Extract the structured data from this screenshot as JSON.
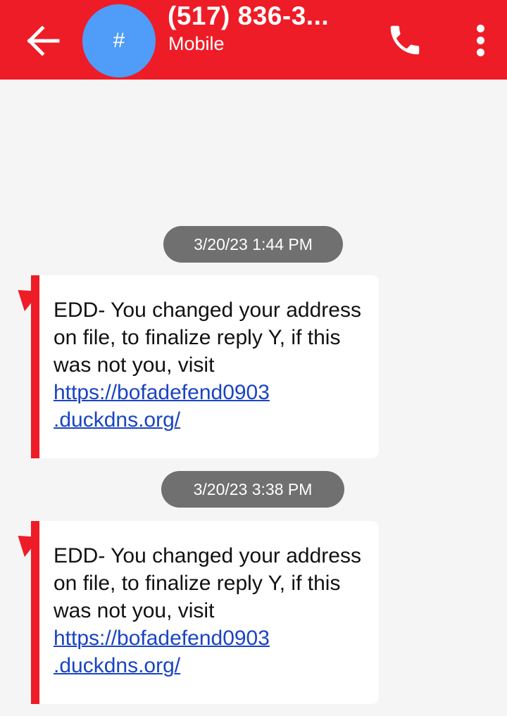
{
  "header": {
    "avatar_text": "#",
    "contact_name": "(517) 836-3...",
    "contact_subtitle": "Mobile",
    "icons": {
      "back": "back-arrow-icon",
      "call": "phone-icon",
      "more": "more-vertical-icon"
    },
    "colors": {
      "header_bg": "#ee1c27",
      "avatar_bg": "#4f9cf9"
    }
  },
  "conversation": {
    "messages": [
      {
        "timestamp": "3/20/23 1:44 PM",
        "text_before_link": "EDD- You changed your address on file, to finalize reply Y, if this was not you, visit",
        "link_line1": "https://bofadefend0903",
        "link_line2": ".duckdns.org/"
      },
      {
        "timestamp": "3/20/23 3:38 PM",
        "text_before_link": "EDD- You changed your address on file, to finalize reply Y, if this was not you, visit",
        "link_line1": "https://bofadefend0903",
        "link_line2": ".duckdns.org/"
      }
    ]
  }
}
